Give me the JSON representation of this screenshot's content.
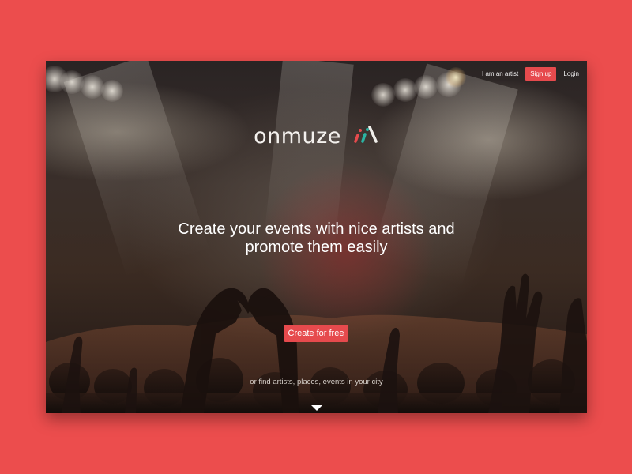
{
  "nav": {
    "artist_link": "I am an artist",
    "signup_label": "Sign up",
    "login_link": "Login"
  },
  "brand": {
    "name": "onmuze",
    "logo_colors": [
      "#e64a4d",
      "#2bb3a3",
      "#f0eeea"
    ]
  },
  "hero": {
    "headline_line1": "Create your events with nice artists and",
    "headline_line2": "promote them easily",
    "cta_label": "Create for free",
    "secondary_text": "or find artists, places, events in your city",
    "scroll_icon": "chevron-down-icon"
  },
  "colors": {
    "background": "#ec4d4d",
    "accent": "#e64a4d"
  }
}
